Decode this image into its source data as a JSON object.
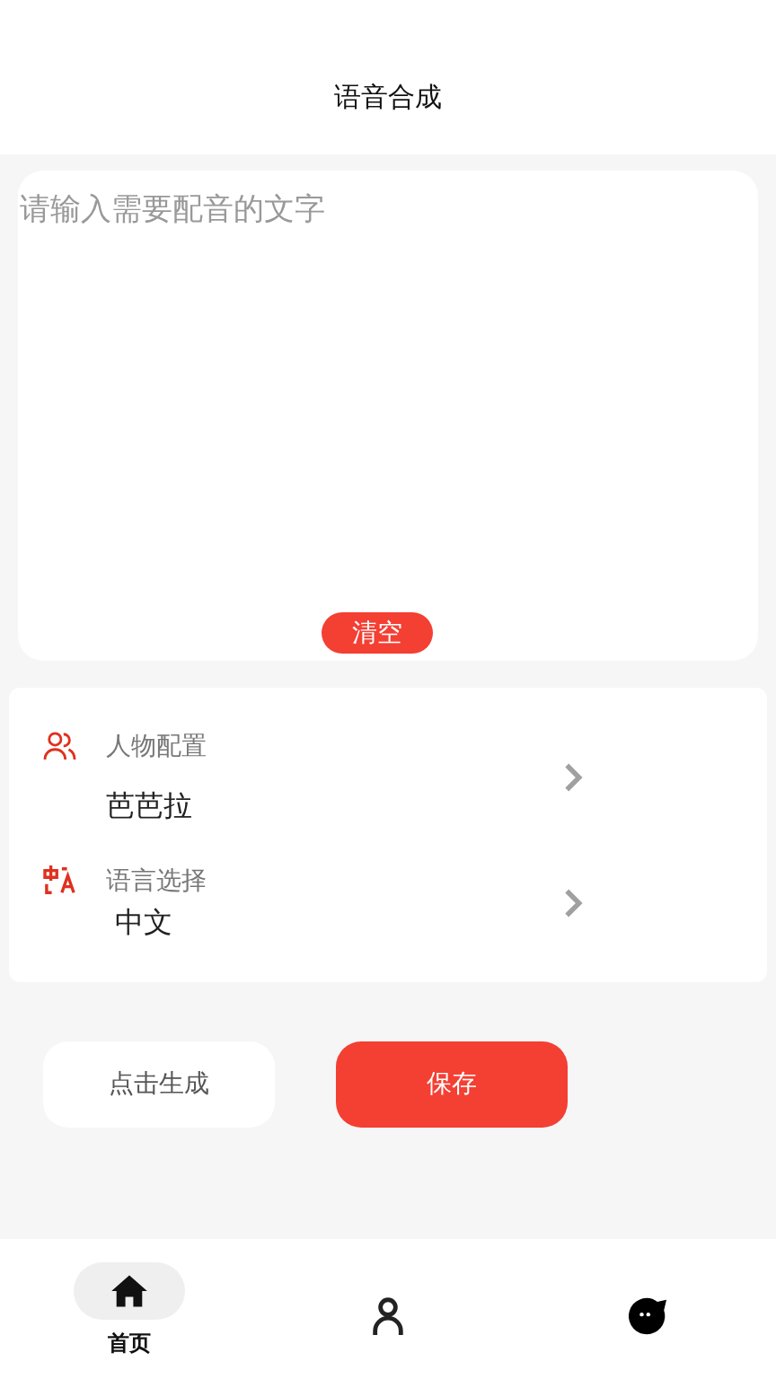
{
  "header": {
    "title": "语音合成"
  },
  "editor": {
    "placeholder": "请输入需要配音的文字",
    "clear_button": "清空"
  },
  "settings": [
    {
      "kind": "people",
      "label": "人物配置",
      "value": "芭芭拉"
    },
    {
      "kind": "language",
      "label": "语言选择",
      "value": "中文"
    }
  ],
  "actions": [
    {
      "label": "点击生成",
      "kind": "secondary"
    },
    {
      "label": "保存",
      "kind": "primary"
    }
  ],
  "tabs": [
    {
      "kind": "home",
      "label": "首页",
      "selected": true
    },
    {
      "kind": "person",
      "selected": false
    },
    {
      "kind": "chat",
      "selected": false
    }
  ]
}
